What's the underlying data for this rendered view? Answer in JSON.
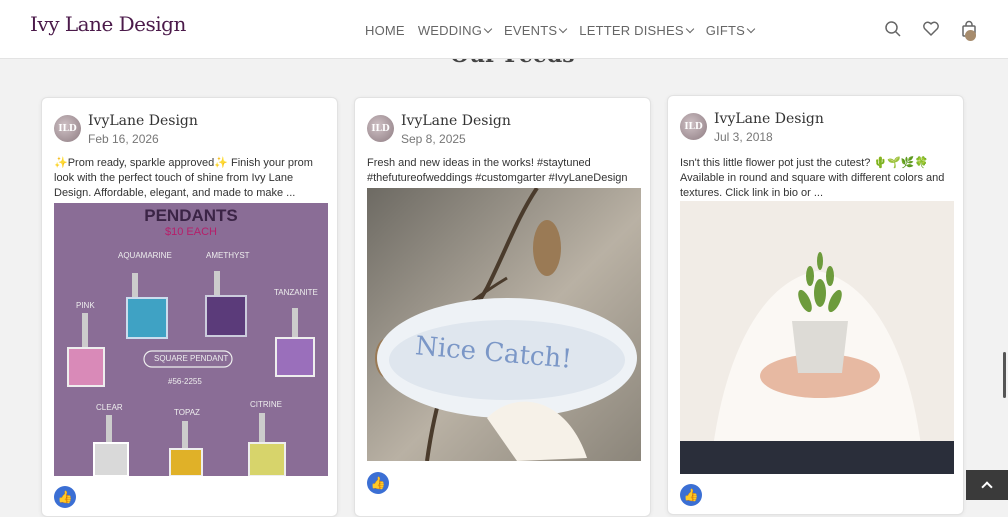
{
  "header": {
    "logo": "Ivy Lane Design",
    "nav": [
      {
        "label": "HOME",
        "has_dropdown": false
      },
      {
        "label": "WEDDING",
        "has_dropdown": true
      },
      {
        "label": "EVENTS",
        "has_dropdown": true
      },
      {
        "label": "LETTER DISHES",
        "has_dropdown": true
      },
      {
        "label": "GIFTS",
        "has_dropdown": true
      }
    ],
    "icons": [
      "search-icon",
      "heart-icon",
      "cart-icon"
    ]
  },
  "section_title": "Our Feeds",
  "posts": [
    {
      "avatar": "ILD",
      "author": "IvyLane Design",
      "date": "Feb 16, 2026",
      "caption": "✨Prom ready, sparkle approved✨ Finish your prom look with the perfect touch of shine from Ivy Lane Design. Affordable, elegant, and made to make ...",
      "image": {
        "title": "PENDANTS",
        "subtitle": "$10 EACH",
        "labels": [
          "AQUAMARINE",
          "AMETHYST",
          "PINK",
          "TANZANITE",
          "SQUARE PENDANT",
          "#56-2255",
          "CLEAR",
          "TOPAZ",
          "CITRINE"
        ]
      }
    },
    {
      "avatar": "ILD",
      "author": "IvyLane Design",
      "date": "Sep 8, 2025",
      "caption": "Fresh and new ideas in the works! #staytuned #thefutureofweddings #customgarter #IvyLaneDesign",
      "image": {
        "text": "Nice Catch!"
      }
    },
    {
      "avatar": "ILD",
      "author": "IvyLane Design",
      "date": "Jul 3, 2018",
      "caption": "Isn't this little flower pot just the cutest? 🌵🌱🌿🍀 Available in round and square with different colors and textures. Click link in bio or ..."
    }
  ],
  "colors": {
    "brand": "#4b1a4a",
    "like": "#3b6fd4",
    "pendant_bg": "#8a6d96"
  }
}
